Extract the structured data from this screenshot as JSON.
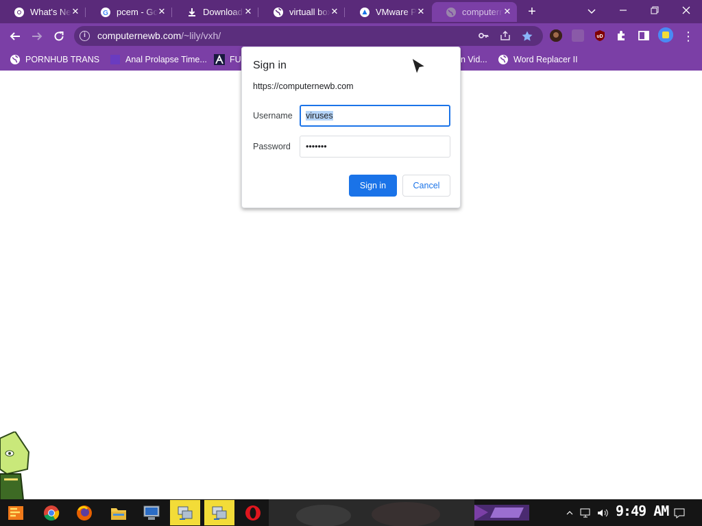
{
  "tabs": [
    {
      "label": "What's New",
      "icon": "chrome-icon"
    },
    {
      "label": "pcem - Google",
      "icon": "google-icon"
    },
    {
      "label": "Downloads",
      "icon": "download-icon"
    },
    {
      "label": "virtuall box",
      "icon": "globe-icon"
    },
    {
      "label": "VMware Player",
      "icon": "vmware-icon"
    },
    {
      "label": "computernewb",
      "icon": "globe-icon",
      "active": true
    }
  ],
  "toolbar": {
    "url_host": "computernewb.com",
    "url_path": "/~lily/vxh/"
  },
  "bookmarks": [
    {
      "label": "PORNHUB TRANS",
      "icon": "globe-icon"
    },
    {
      "label": "Anal Prolapse Time...",
      "icon": "bookmark-favicon"
    },
    {
      "label": "FU",
      "icon": "lambda-icon"
    },
    {
      "label": "n Vid...",
      "icon": ""
    },
    {
      "label": "Word Replacer II",
      "icon": "globe-icon"
    }
  ],
  "dialog": {
    "title": "Sign in",
    "origin": "https://computernewb.com",
    "username_label": "Username",
    "username_value": "viruses",
    "password_label": "Password",
    "password_value": "•••••••",
    "sign_in_label": "Sign in",
    "cancel_label": "Cancel"
  },
  "taskbar": {
    "clock": "9:49 AM",
    "apps": [
      "start-icon",
      "chrome-icon",
      "firefox-icon",
      "file-explorer-icon",
      "computer-icon",
      "network-app-icon",
      "network-app-icon",
      "opera-icon"
    ]
  },
  "colors": {
    "tabstrip": "#5a2a7a",
    "toolbar": "#7b3fa6",
    "accent": "#1a73e8",
    "taskbar_highlight": "#f3dc38"
  }
}
